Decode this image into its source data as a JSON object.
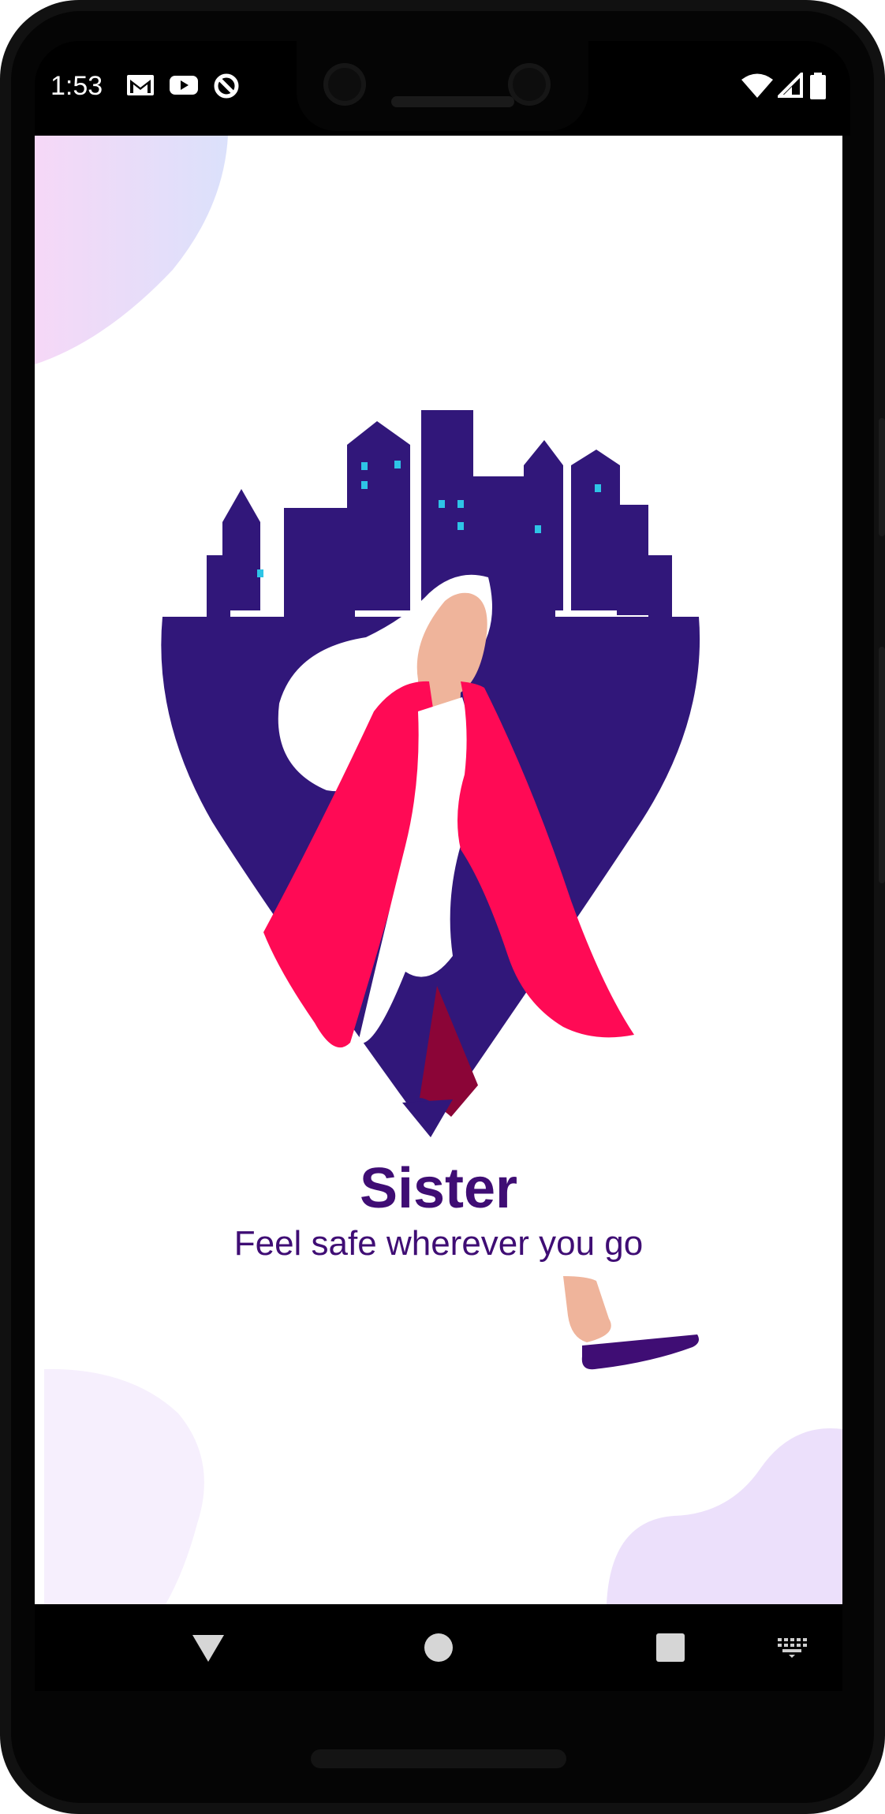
{
  "status_bar": {
    "time": "1:53",
    "left_icons": [
      "gmail-icon",
      "youtube-icon",
      "data-saver-icon"
    ],
    "right_icons": [
      "wifi-icon",
      "cell-signal-icon",
      "battery-icon"
    ]
  },
  "splash": {
    "app_name": "Sister",
    "tagline": "Feel safe wherever you go",
    "illustration": "woman-walking-city-pin-illustration"
  },
  "colors": {
    "brand_purple": "#3f0d74",
    "pin_purple": "#31177a",
    "coat_pink": "#ff0a55",
    "window_cyan": "#2ec4e6",
    "skin": "#efb49b",
    "blob_lavender": "#ece0fb"
  },
  "nav_bar": {
    "buttons": [
      "back-icon",
      "home-icon",
      "recents-icon",
      "keyboard-icon"
    ]
  }
}
